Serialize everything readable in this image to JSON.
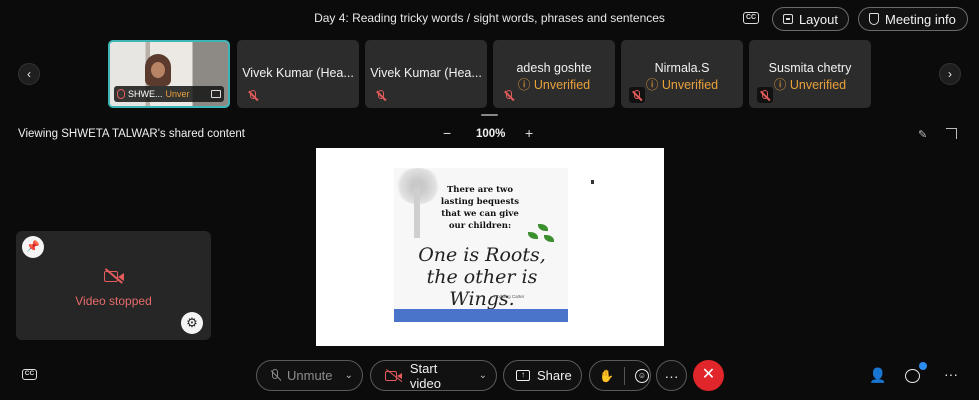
{
  "header": {
    "meeting_title": "Day 4: Reading tricky words / sight words, phrases and sentences",
    "cc_label": "CC",
    "layout_label": "Layout",
    "meeting_info_label": "Meeting info"
  },
  "strip": {
    "tiles": [
      {
        "name": "SHWE...",
        "status": "Unver"
      },
      {
        "name": "Vivek Kumar (Hea..."
      },
      {
        "name": "Vivek Kumar (Hea..."
      },
      {
        "name": "adesh goshte",
        "status": "Unverified"
      },
      {
        "name": "Nirmala.S",
        "status": "Unverified"
      },
      {
        "name": "Susmita chetry",
        "status": "Unverified"
      }
    ],
    "left_arrow": "‹",
    "right_arrow": "›"
  },
  "content_bar": {
    "viewing_text": "Viewing SHWETA TALWAR's shared content",
    "zoom_minus": "−",
    "zoom_level": "100%",
    "zoom_plus": "+"
  },
  "shared_slide": {
    "line1": "There are two",
    "line2": "lasting bequests",
    "line3": "that we can give",
    "line4": "our children:",
    "big1": "One is Roots,",
    "big2": "the other is Wings.",
    "author": "~ Hodding Carter"
  },
  "self_view": {
    "status": "Video stopped"
  },
  "controls": {
    "unmute_label": "Unmute",
    "start_video_label": "Start video",
    "share_label": "Share",
    "more_label": "···",
    "end_label": "✕",
    "cc_label": "CC",
    "chevron": "⌄"
  },
  "colors": {
    "accent": "#3fb6b6",
    "unverified": "#e9a13b",
    "muted_red": "#e45b5b",
    "end_call": "#e0252b",
    "notification": "#2d8cf0"
  }
}
